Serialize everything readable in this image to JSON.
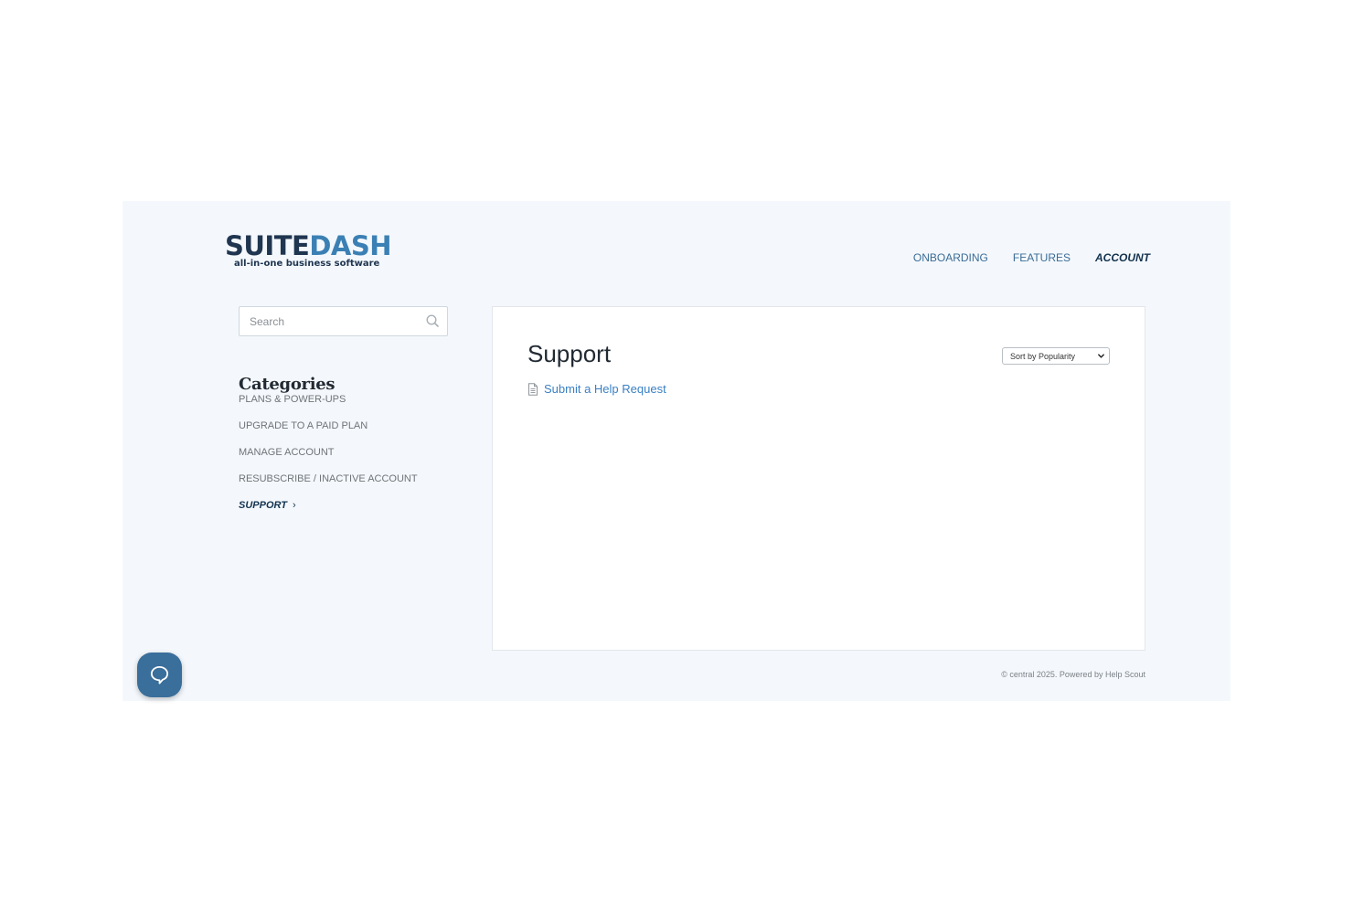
{
  "brand": {
    "logo_part1": "SUITE",
    "logo_part2": "DASH",
    "tagline": "all-in-one business software"
  },
  "nav": {
    "items": [
      {
        "label": "ONBOARDING",
        "active": false
      },
      {
        "label": "FEATURES",
        "active": false
      },
      {
        "label": "ACCOUNT",
        "active": true
      }
    ]
  },
  "search": {
    "placeholder": "Search",
    "value": ""
  },
  "categories": {
    "title": "Categories",
    "items": [
      {
        "label": "PLANS & POWER-UPS"
      },
      {
        "label": "UPGRADE TO A PAID PLAN"
      },
      {
        "label": "MANAGE ACCOUNT"
      },
      {
        "label": "RESUBSCRIBE / INACTIVE ACCOUNT"
      },
      {
        "label": "SUPPORT",
        "active": true
      }
    ]
  },
  "main": {
    "title": "Support",
    "sort": {
      "selected": "Sort by Popularity"
    },
    "articles": [
      {
        "title": "Submit a Help Request"
      }
    ]
  },
  "footer": {
    "copyright": "© central 2025.",
    "powered_prefix": "Powered by",
    "powered_link": "Help Scout"
  },
  "colors": {
    "background": "#f4f8fc",
    "accent": "#3b80c4",
    "brand_dark": "#1f3550",
    "beacon": "#3a6e9b"
  }
}
